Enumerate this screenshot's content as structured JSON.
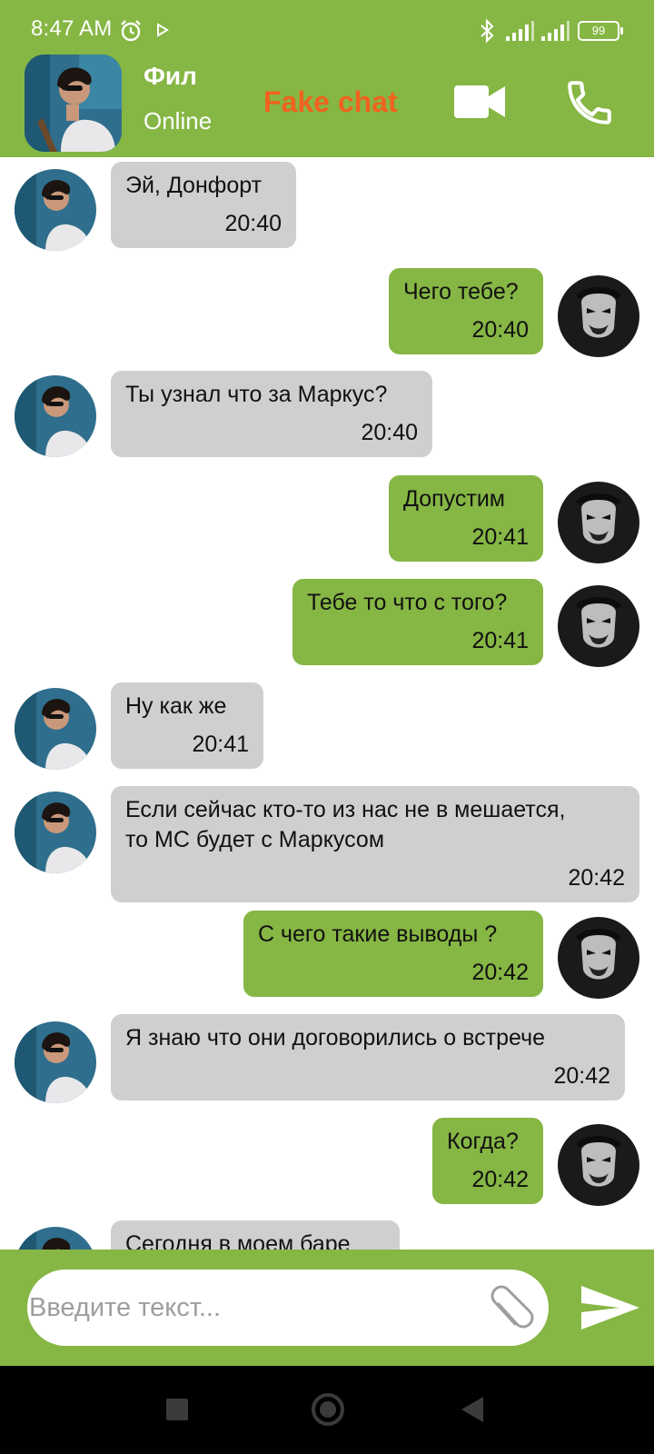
{
  "status_bar": {
    "time": "8:47 AM",
    "battery": "99"
  },
  "header": {
    "contact_name": "Фил",
    "contact_status": "Online",
    "app_label": "Fake chat"
  },
  "messages": [
    {
      "text": "Эй, Донфорт",
      "time": "20:40"
    },
    {
      "text": "Чего тебе?",
      "time": "20:40"
    },
    {
      "text": "Ты узнал что за Маркус?",
      "time": "20:40"
    },
    {
      "text": "Допустим",
      "time": "20:41"
    },
    {
      "text": "Тебе то что с того?",
      "time": "20:41"
    },
    {
      "text": "Ну как же",
      "time": "20:41"
    },
    {
      "text": "Если сейчас кто-то из нас не в мешается,\nто МС будет с Маркусом",
      "time": "20:42"
    },
    {
      "text": "С чего такие выводы ?",
      "time": "20:42"
    },
    {
      "text": "Я знаю что они договорились о встрече",
      "time": "20:42"
    },
    {
      "text": "Когда?",
      "time": "20:42"
    },
    {
      "text": "Сегодня в моем баре",
      "time": ""
    }
  ],
  "input": {
    "placeholder": "Введите текст..."
  },
  "colors": {
    "accent": "#86b644",
    "incoming_bubble": "#cfcfd1",
    "fake_label": "#f0621e"
  }
}
